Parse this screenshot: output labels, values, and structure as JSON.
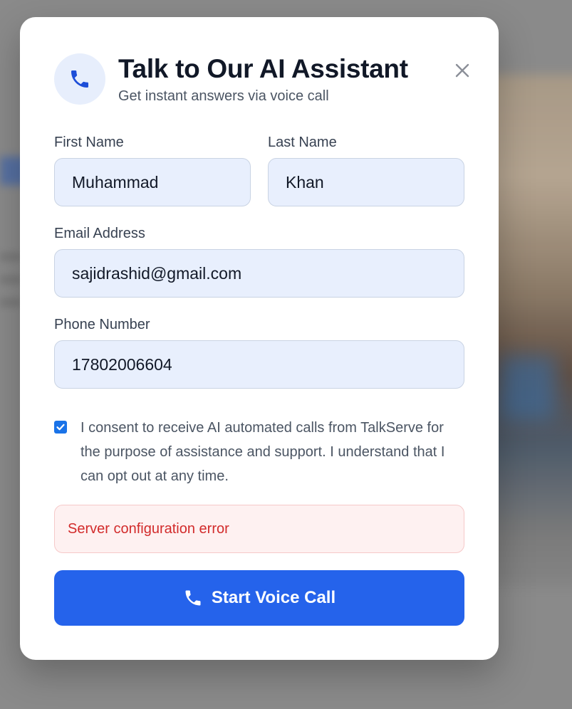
{
  "modal": {
    "title": "Talk to Our AI Assistant",
    "subtitle": "Get instant answers via voice call",
    "header_icon": "phone-icon",
    "close_icon": "close-icon"
  },
  "form": {
    "first_name": {
      "label": "First Name",
      "value": "Muhammad"
    },
    "last_name": {
      "label": "Last Name",
      "value": "Khan"
    },
    "email": {
      "label": "Email Address",
      "value": "sajidrashid@gmail.com"
    },
    "phone": {
      "label": "Phone Number",
      "value": "17802006604"
    },
    "consent": {
      "checked": true,
      "text": "I consent to receive AI automated calls from TalkServe for the purpose of assistance and support. I understand that I can opt out at any time."
    }
  },
  "error": {
    "message": "Server configuration error"
  },
  "submit": {
    "label": "Start Voice Call",
    "icon": "phone-icon"
  },
  "colors": {
    "accent": "#2563eb",
    "error_text": "#d22b2b",
    "error_bg": "#fef1f1",
    "input_bg": "#e8effd"
  }
}
